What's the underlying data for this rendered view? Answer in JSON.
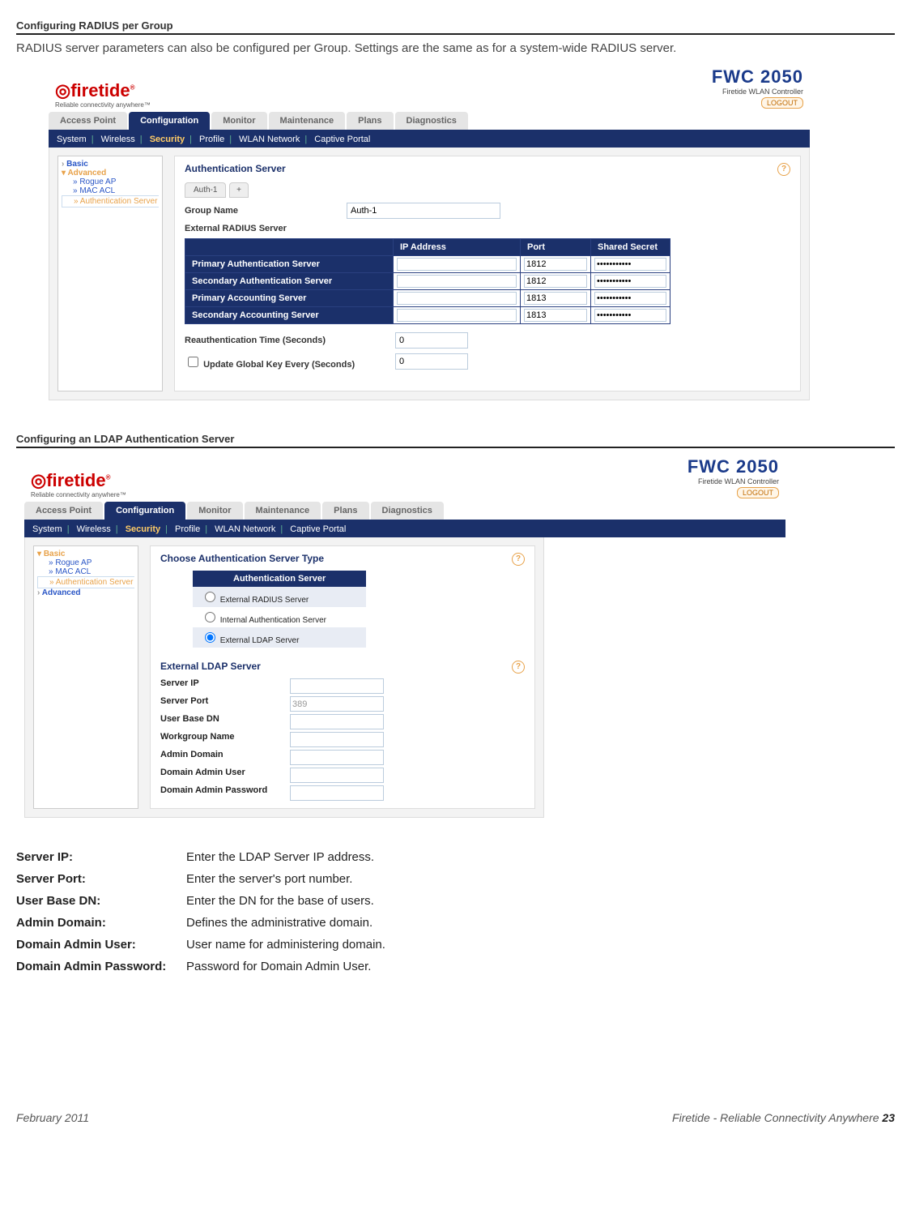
{
  "section1": {
    "title": "Configuring RADIUS per Group",
    "desc": "RADIUS server parameters can also be configured per Group. Settings are the same as for a system-wide RADIUS server."
  },
  "section2": {
    "title": "Configuring an LDAP Authentication Server"
  },
  "brand": {
    "logo": "firetide",
    "tagline": "Reliable connectivity anywhere™",
    "product": "FWC 2050",
    "product_sub": "Firetide WLAN Controller",
    "logout": "LOGOUT"
  },
  "main_tabs": [
    "Access Point",
    "Configuration",
    "Monitor",
    "Maintenance",
    "Plans",
    "Diagnostics"
  ],
  "subnav": [
    "System",
    "Wireless",
    "Security",
    "Profile",
    "WLAN Network",
    "Captive Portal"
  ],
  "shot1": {
    "side": {
      "basic": "Basic",
      "advanced": "Advanced",
      "links": [
        "» Rogue AP",
        "» MAC ACL",
        "» Authentication Server"
      ]
    },
    "panel_title": "Authentication Server",
    "tab_label": "Auth-1",
    "group_name_label": "Group Name",
    "group_name_value": "Auth-1",
    "ext_label": "External RADIUS Server",
    "cols": [
      "",
      "IP Address",
      "Port",
      "Shared Secret"
    ],
    "rows": [
      {
        "name": "Primary Authentication Server",
        "ip": "",
        "port": "1812",
        "secret": "•••••••••••"
      },
      {
        "name": "Secondary Authentication Server",
        "ip": "",
        "port": "1812",
        "secret": "•••••••••••"
      },
      {
        "name": "Primary Accounting Server",
        "ip": "",
        "port": "1813",
        "secret": "•••••••••••"
      },
      {
        "name": "Secondary Accounting Server",
        "ip": "",
        "port": "1813",
        "secret": "•••••••••••"
      }
    ],
    "reauth_label": "Reauthentication Time (Seconds)",
    "reauth_value": "0",
    "update_label": "Update Global Key Every (Seconds)",
    "update_value": "0"
  },
  "shot2": {
    "side": {
      "basic": "Basic",
      "links": [
        "» Rogue AP",
        "» MAC ACL",
        "» Authentication Server"
      ],
      "advanced": "Advanced"
    },
    "choose_title": "Choose Authentication Server Type",
    "auth_header": "Authentication Server",
    "options": [
      "External RADIUS Server",
      "Internal Authentication Server",
      "External LDAP Server"
    ],
    "ldap_title": "External LDAP Server",
    "fields": [
      {
        "label": "Server IP",
        "value": ""
      },
      {
        "label": "Server Port",
        "value": "389"
      },
      {
        "label": "User Base DN",
        "value": ""
      },
      {
        "label": "Workgroup Name",
        "value": ""
      },
      {
        "label": "Admin Domain",
        "value": ""
      },
      {
        "label": "Domain Admin User",
        "value": ""
      },
      {
        "label": "Domain Admin Password",
        "value": ""
      }
    ]
  },
  "definitions": [
    {
      "k": "Server IP:",
      "v": "Enter the LDAP Server IP address."
    },
    {
      "k": "Server Port:",
      "v": "Enter the server's port number."
    },
    {
      "k": "User Base DN:",
      "v": "Enter the DN for the base of users."
    },
    {
      "k": "Admin Domain:",
      "v": "Defines the administrative domain."
    },
    {
      "k": "Domain Admin User:",
      "v": "User name for administering domain."
    },
    {
      "k": "Domain Admin Password:",
      "v": "Password for Domain Admin User."
    }
  ],
  "footer": {
    "date": "February 2011",
    "right_text": "Firetide - Reliable Connectivity Anywhere",
    "page": "23"
  }
}
